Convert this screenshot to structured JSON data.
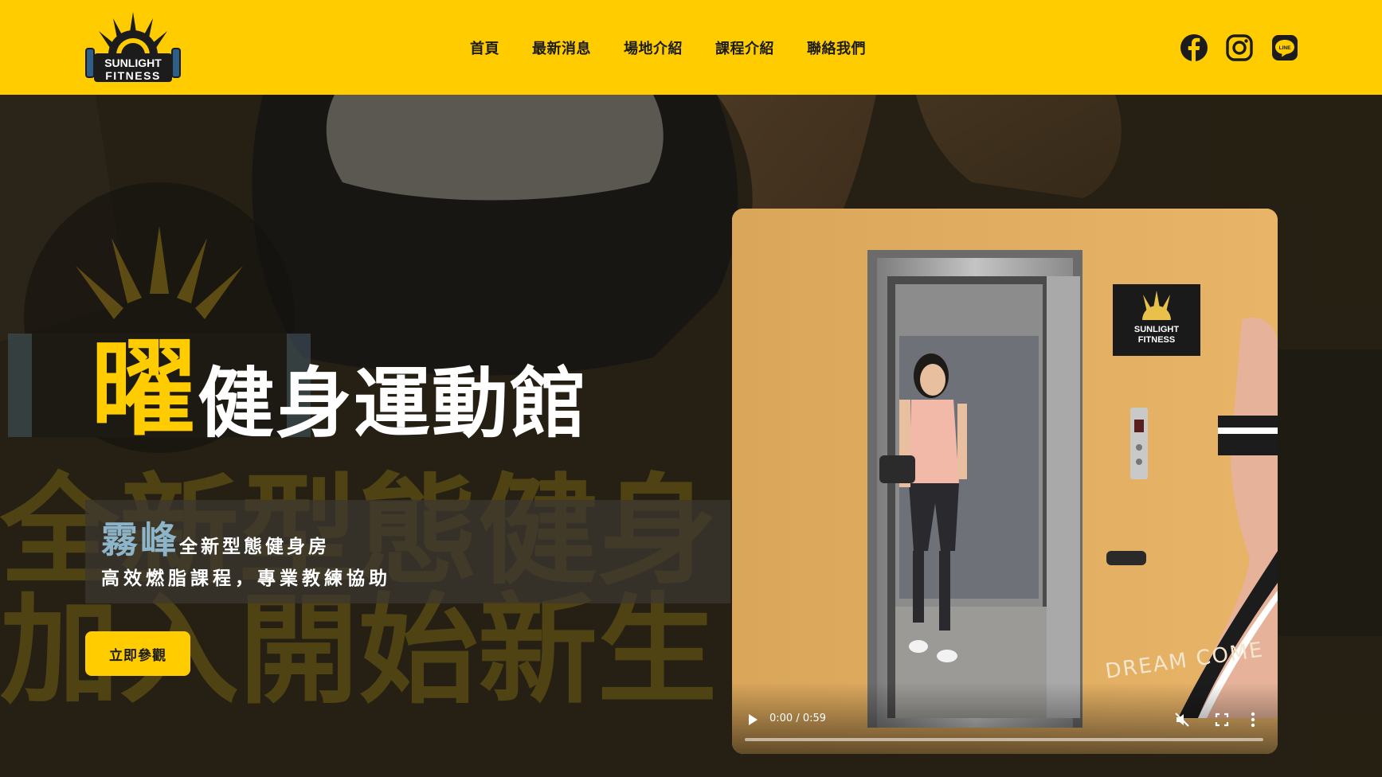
{
  "header": {
    "logo": {
      "line1": "SUNLIGHT",
      "line2": "FITNESS"
    },
    "nav": [
      {
        "label": "首頁"
      },
      {
        "label": "最新消息"
      },
      {
        "label": "場地介紹"
      },
      {
        "label": "課程介紹"
      },
      {
        "label": "聯絡我們"
      }
    ],
    "social": [
      {
        "icon": "facebook-icon"
      },
      {
        "icon": "instagram-icon"
      },
      {
        "icon": "line-icon"
      }
    ]
  },
  "hero": {
    "title_accent": "曜",
    "title_rest": "健身運動館",
    "subtitle_accent": "霧峰",
    "subtitle_tag": "全新型態健身房",
    "subtitle_line2": "高效燃脂課程，專業教練協助",
    "cta_label": "立即參觀",
    "background": {
      "banner_line1": "全新型態健身",
      "banner_line2": "加入開始新生"
    }
  },
  "video": {
    "sign_line1": "SUNLIGHT",
    "sign_line2": "FITNESS",
    "wall_text": "DREAM COME",
    "time": "0:00 / 0:59",
    "progress": 0,
    "muted": true
  },
  "colors": {
    "brand_yellow": "#ffcc00",
    "accent_blue": "#8db4c9",
    "text_dark": "#1c1c1c"
  }
}
